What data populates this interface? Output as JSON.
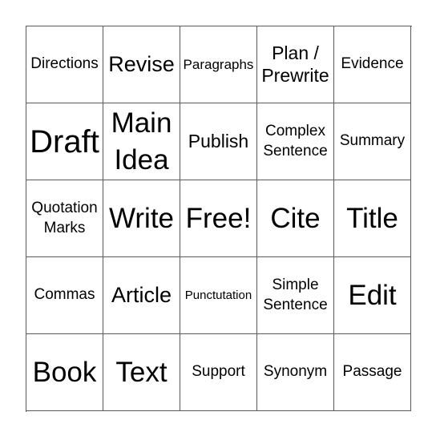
{
  "board": {
    "cells": [
      {
        "text": "Directions",
        "size": "s-s"
      },
      {
        "text": "Revise",
        "size": "s-m"
      },
      {
        "text": "Paragraphs",
        "size": "s-xs"
      },
      {
        "text": "Plan /\nPrewrite",
        "size": "s-ms"
      },
      {
        "text": "Evidence",
        "size": "s-s"
      },
      {
        "text": "Draft",
        "size": "s-xl"
      },
      {
        "text": "Main\nIdea",
        "size": "s-l"
      },
      {
        "text": "Publish",
        "size": "s-ms"
      },
      {
        "text": "Complex\nSentence",
        "size": "s-s"
      },
      {
        "text": "Summary",
        "size": "s-s"
      },
      {
        "text": "Quotation\nMarks",
        "size": "s-s"
      },
      {
        "text": "Write",
        "size": "s-l"
      },
      {
        "text": "Free!",
        "size": "s-l"
      },
      {
        "text": "Cite",
        "size": "s-l"
      },
      {
        "text": "Title",
        "size": "s-l"
      },
      {
        "text": "Commas",
        "size": "s-s"
      },
      {
        "text": "Article",
        "size": "s-m"
      },
      {
        "text": "Punctutation",
        "size": "s-xxs"
      },
      {
        "text": "Simple\nSentence",
        "size": "s-s"
      },
      {
        "text": "Edit",
        "size": "s-l"
      },
      {
        "text": "Book",
        "size": "s-l"
      },
      {
        "text": "Text",
        "size": "s-l"
      },
      {
        "text": "Support",
        "size": "s-s"
      },
      {
        "text": "Synonym",
        "size": "s-s"
      },
      {
        "text": "Passage",
        "size": "s-s"
      }
    ]
  }
}
